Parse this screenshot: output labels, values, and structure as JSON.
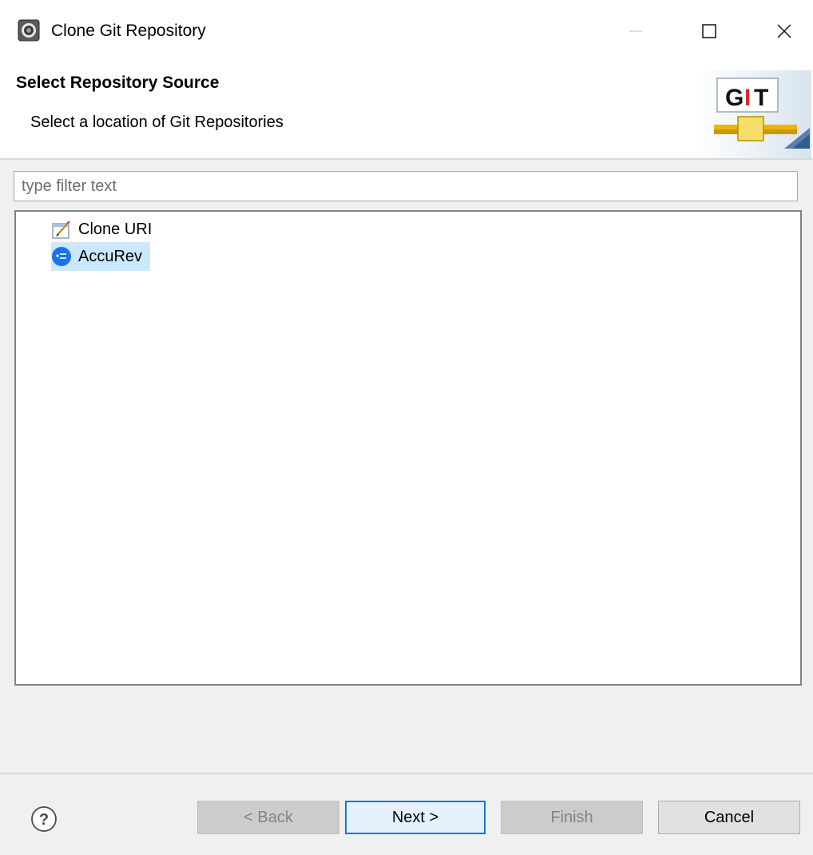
{
  "window": {
    "title": "Clone Git Repository",
    "minimize_icon": "minimize-icon",
    "maximize_icon": "maximize-icon",
    "close_icon": "close-icon"
  },
  "banner": {
    "title": "Select Repository Source",
    "subtitle": "Select a location of Git Repositories",
    "logo_text": "GIT"
  },
  "filter": {
    "placeholder": "type filter text",
    "value": ""
  },
  "tree": {
    "items": [
      {
        "label": "Clone URI",
        "icon": "clone-uri-icon",
        "selected": false
      },
      {
        "label": "AccuRev",
        "icon": "accurev-icon",
        "selected": true
      }
    ]
  },
  "footer": {
    "help_icon": "help-icon",
    "buttons": {
      "back": "< Back",
      "next": "Next >",
      "finish": "Finish",
      "cancel": "Cancel"
    }
  },
  "colors": {
    "selection": "#cce8ff",
    "default_button_border": "#0078d7",
    "accurev_blue": "#1a73e8"
  }
}
